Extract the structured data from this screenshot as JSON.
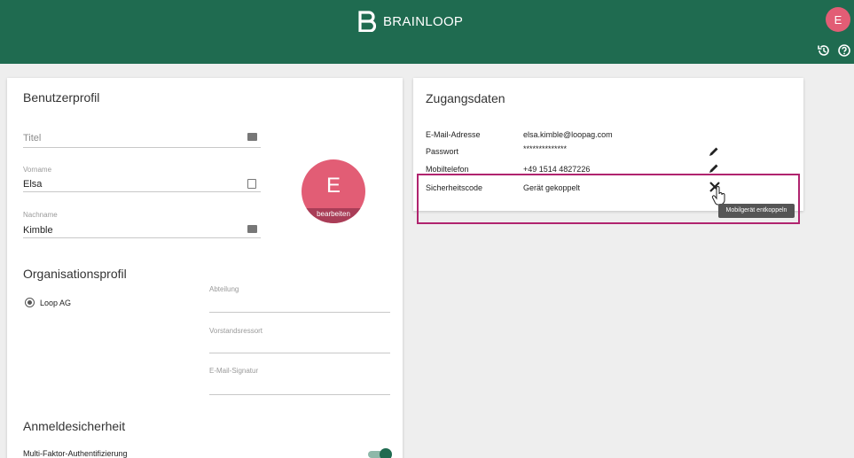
{
  "header": {
    "brand": "BRAINLOOP",
    "user_initial": "E",
    "icons": [
      "history-icon",
      "help-icon"
    ]
  },
  "user_profile": {
    "title": "Benutzerprofil",
    "fields": {
      "titel": {
        "placeholder": "Titel",
        "value": ""
      },
      "vorname": {
        "label": "Vorname",
        "value": "Elsa"
      },
      "nachname": {
        "label": "Nachname",
        "value": "Kimble"
      }
    },
    "avatar": {
      "initial": "E",
      "edit_label": "bearbeiten"
    }
  },
  "org_profile": {
    "title": "Organisationsprofil",
    "organization": "Loop AG",
    "fields": {
      "abteilung": "Abteilung",
      "vorstandsressort": "Vorstandsressort",
      "email_signatur": "E-Mail-Signatur"
    }
  },
  "login_security": {
    "title": "Anmeldesicherheit",
    "mfa_label": "Multi-Faktor-Authentifizierung",
    "mfa_enabled": true
  },
  "access_data": {
    "title": "Zugangsdaten",
    "rows": [
      {
        "label": "E-Mail-Adresse",
        "value": "elsa.kimble@loopag.com"
      },
      {
        "label": "Passwort",
        "value": "**************"
      },
      {
        "label": "Mobiltelefon",
        "value": "+49 1514 4827226"
      },
      {
        "label": "Sicherheitscode",
        "value": "Gerät gekoppelt"
      }
    ],
    "unlink_tooltip": "Mobilgerät entkoppeln"
  },
  "colors": {
    "header_bg": "#1f6b50",
    "avatar": "#e25d75",
    "highlight": "#b0246e"
  }
}
